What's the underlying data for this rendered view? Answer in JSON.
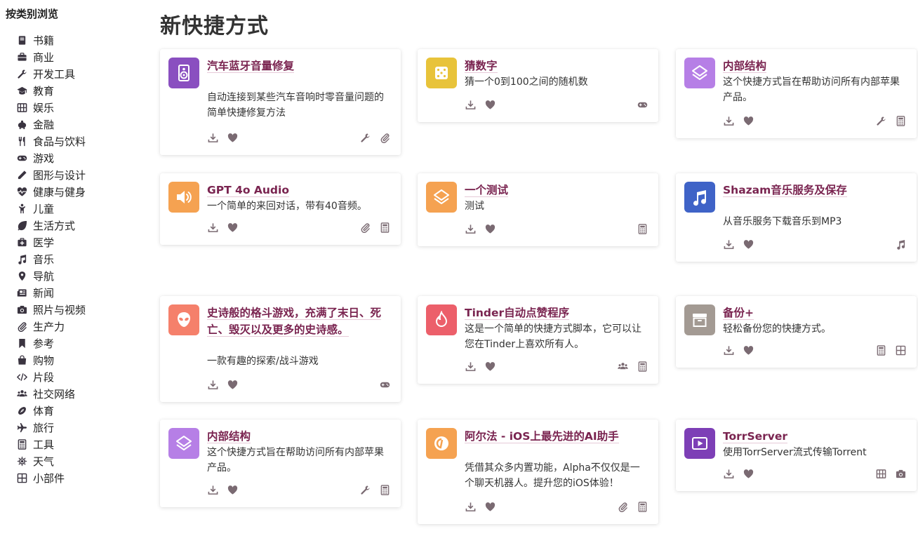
{
  "sidebar": {
    "title": "按类别浏览",
    "items": [
      {
        "label": "书籍",
        "icon": "book-icon"
      },
      {
        "label": "商业",
        "icon": "briefcase-icon"
      },
      {
        "label": "开发工具",
        "icon": "wrench-icon"
      },
      {
        "label": "教育",
        "icon": "graduation-cap-icon"
      },
      {
        "label": "娱乐",
        "icon": "film-icon"
      },
      {
        "label": "金融",
        "icon": "piggy-bank-icon"
      },
      {
        "label": "食品与饮料",
        "icon": "utensils-icon"
      },
      {
        "label": "游戏",
        "icon": "gamepad-icon"
      },
      {
        "label": "图形与设计",
        "icon": "pencil-icon"
      },
      {
        "label": "健康与健身",
        "icon": "heartbeat-icon"
      },
      {
        "label": "儿童",
        "icon": "child-icon"
      },
      {
        "label": "生活方式",
        "icon": "leaf-icon"
      },
      {
        "label": "医学",
        "icon": "medkit-icon"
      },
      {
        "label": "音乐",
        "icon": "music-icon"
      },
      {
        "label": "导航",
        "icon": "map-marker-icon"
      },
      {
        "label": "新闻",
        "icon": "newspaper-icon"
      },
      {
        "label": "照片与视频",
        "icon": "camera-icon"
      },
      {
        "label": "生产力",
        "icon": "paperclip-icon"
      },
      {
        "label": "参考",
        "icon": "bookmark-icon"
      },
      {
        "label": "购物",
        "icon": "shopping-bag-icon"
      },
      {
        "label": "片段",
        "icon": "code-icon"
      },
      {
        "label": "社交网络",
        "icon": "users-icon"
      },
      {
        "label": "体育",
        "icon": "football-icon"
      },
      {
        "label": "旅行",
        "icon": "plane-icon"
      },
      {
        "label": "工具",
        "icon": "calculator-icon"
      },
      {
        "label": "天气",
        "icon": "sun-icon"
      },
      {
        "label": "小部件",
        "icon": "widget-grid-icon"
      }
    ]
  },
  "main": {
    "title": "新快捷方式",
    "cards": [
      {
        "title": "汽车蓝牙音量修复",
        "desc": "自动连接到某些汽车音响时零音量问题的简单快捷修复方法",
        "tile_color": "#8a4fc0",
        "tile_icon": "speaker-icon",
        "categories": [
          "wrench-icon",
          "paperclip-icon"
        ]
      },
      {
        "title": "猜数字",
        "desc": "猜一个0到100之间的随机数",
        "tile_color": "#e8c33a",
        "tile_icon": "dice-icon",
        "categories": [
          "gamepad-icon"
        ]
      },
      {
        "title": "内部结构",
        "desc": "这个快捷方式旨在帮助访问所有内部苹果产品。",
        "tile_color": "#b67fe6",
        "tile_icon": "layers-icon",
        "categories": [
          "wrench-icon",
          "calculator-icon"
        ]
      },
      {
        "title": "GPT 4o Audio",
        "desc": "一个简单的来回对话，带有40音频。",
        "tile_color": "#f5a251",
        "tile_icon": "volume-icon",
        "categories": [
          "paperclip-icon",
          "calculator-icon"
        ]
      },
      {
        "title": "一个测试",
        "desc": "测试",
        "tile_color": "#f5a251",
        "tile_icon": "layers-icon",
        "categories": [
          "calculator-icon"
        ]
      },
      {
        "title": "Shazam音乐服务及保存",
        "desc": "从音乐服务下载音乐到MP3",
        "tile_color": "#3f63c7",
        "tile_icon": "music-note-icon",
        "categories": [
          "music-icon"
        ]
      },
      {
        "title": "史诗般的格斗游戏，充满了末日、死亡、毁灭以及更多的史诗感。",
        "desc": "一款有趣的探索/战斗游戏",
        "tile_color": "#f5806b",
        "tile_icon": "alien-icon",
        "categories": [
          "gamepad-icon"
        ]
      },
      {
        "title": "Tinder自动点赞程序",
        "desc": "这是一个简单的快捷方式脚本，它可以让您在Tinder上喜欢所有人。",
        "tile_color": "#ec5f6a",
        "tile_icon": "flame-icon",
        "categories": [
          "users-icon",
          "calculator-icon"
        ]
      },
      {
        "title": "备份+",
        "desc": "轻松备份您的快捷方式。",
        "tile_color": "#a39a93",
        "tile_icon": "archive-icon",
        "categories": [
          "calculator-icon",
          "widget-grid-icon"
        ]
      },
      {
        "title": "内部结构",
        "desc": "这个快捷方式旨在帮助访问所有内部苹果产品。",
        "tile_color": "#b67fe6",
        "tile_icon": "layers-icon",
        "categories": [
          "wrench-icon",
          "calculator-icon"
        ]
      },
      {
        "title": "阿尔法 - iOS上最先进的AI助手",
        "desc": "凭借其众多内置功能，Alpha不仅仅是一个聊天机器人。提升您的iOS体验！",
        "tile_color": "#f5a251",
        "tile_icon": "alpha-logo-icon",
        "categories": [
          "paperclip-icon",
          "calculator-icon"
        ]
      },
      {
        "title": "TorrServer",
        "desc": "使用TorrServer流式传输Torrent",
        "tile_color": "#7d3fb6",
        "tile_icon": "play-icon",
        "categories": [
          "film-icon",
          "camera-icon"
        ]
      }
    ]
  }
}
